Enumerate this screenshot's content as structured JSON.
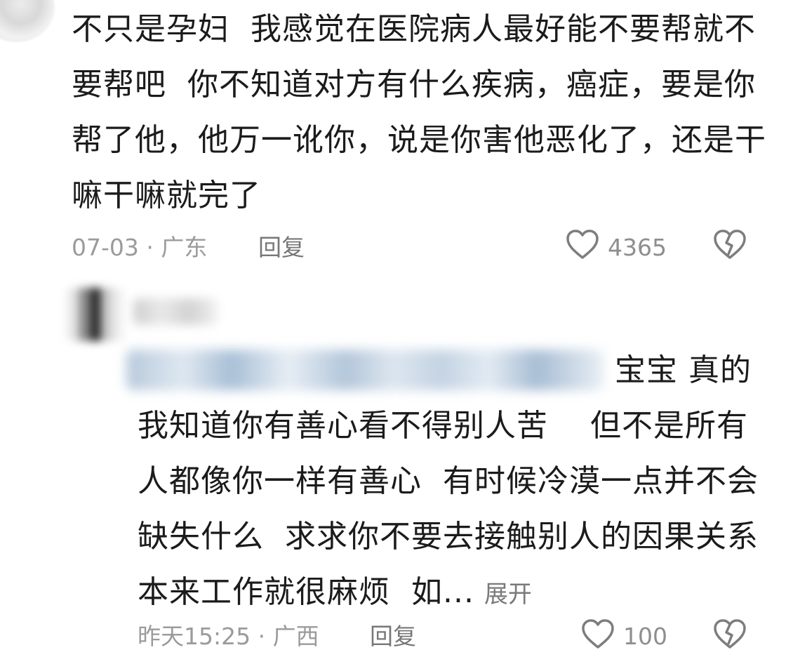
{
  "comment1": {
    "text": "不只是孕妇  我感觉在医院病人最好能不要帮就不\n要帮吧  你不知道对方有什么疾病，癌症，要是你\n帮了他，他万一讹你，说是你害他恶化了，还是干\n嘛干嘛就完了",
    "date": "07-03",
    "location": "广东",
    "reply_label": "回复",
    "likes": "4365",
    "icons": {
      "like": "heart-outline-icon",
      "dislike": "broken-heart-icon"
    }
  },
  "comment2": {
    "first_line_tail": "宝宝  真的",
    "text": "我知道你有善心看不得别人苦    但不是所有\n人都像你一样有善心  有时候冷漠一点并不会\n缺失什么  求求你不要去接触别人的因果关系\n本来工作就很麻烦  如...",
    "expand_label": "展开",
    "date": "昨天15:25",
    "location": "广西",
    "reply_label": "回复",
    "likes": "100",
    "icons": {
      "like": "heart-outline-icon",
      "dislike": "broken-heart-icon"
    }
  },
  "colors": {
    "text": "#1b1b1b",
    "meta": "#9b9b9b",
    "icon": "#7d7d7d",
    "background": "#ffffff"
  }
}
